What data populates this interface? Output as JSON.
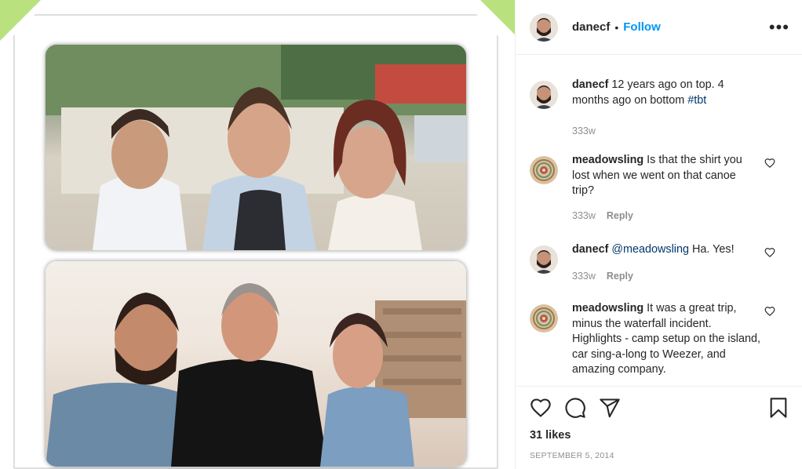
{
  "post": {
    "author": "danecf",
    "follow_label": "Follow",
    "dot": "•",
    "more_label": "•••",
    "likes": "31 likes",
    "date": "September 5, 2014",
    "caption": {
      "user": "danecf",
      "text": "12 years ago on top. 4 months ago on bottom",
      "hashtag": "#tbt",
      "time": "333w"
    }
  },
  "comments": [
    {
      "user": "meadowsling",
      "text": "Is that the shirt you lost when we went on that canoe trip?",
      "time": "333w",
      "reply": "Reply",
      "avatar": "mandala-avatar"
    },
    {
      "user": "danecf",
      "mention": "@meadowsling",
      "text": "Ha. Yes!",
      "time": "333w",
      "reply": "Reply",
      "avatar": "bearded-man-avatar"
    },
    {
      "user": "meadowsling",
      "text": "It was a great trip, minus the waterfall incident. Highlights - camp setup on the island, car sing-a-long to Weezer, and amazing company.",
      "time": "",
      "reply": "",
      "avatar": "mandala-avatar"
    }
  ],
  "icons": {
    "like": "heart-icon",
    "comment": "comment-icon",
    "share": "send-icon",
    "save": "bookmark-icon",
    "comment_like": "small-heart-icon"
  },
  "colors": {
    "accent": "#0095f6",
    "link": "#00376b",
    "muted": "#8e8e8e",
    "corner_green": "#b9e27e"
  }
}
